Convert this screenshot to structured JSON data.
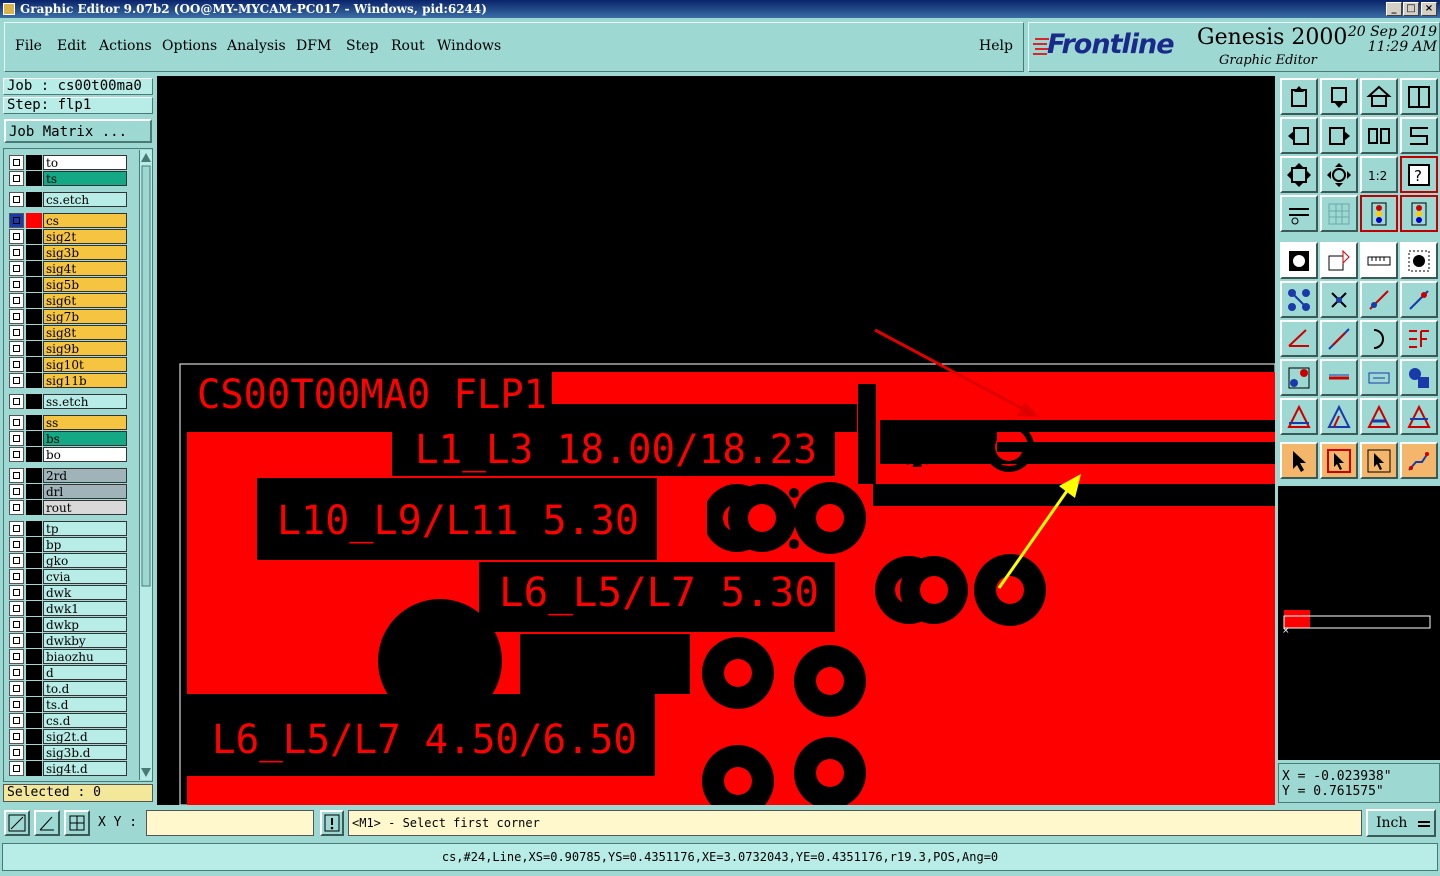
{
  "window": {
    "title": "Graphic Editor 9.07b2 (OO@MY-MYCAM-PC017 - Windows, pid:6244)",
    "buttons": [
      "_",
      "□",
      "×"
    ]
  },
  "menu": {
    "items": [
      "File",
      "Edit",
      "Actions",
      "Options",
      "Analysis",
      "DFM",
      "Step",
      "Rout",
      "Windows"
    ],
    "help": "Help"
  },
  "logo": {
    "brand": "Frontline",
    "product": "Genesis 2000",
    "subtitle": "Graphic Editor",
    "date": "20 Sep 2019",
    "time": "11:29 AM"
  },
  "job": {
    "job": "Job : cs00t00ma0",
    "step": "Step: flp1",
    "matrix_button": "Job Matrix ..."
  },
  "layers": [
    {
      "name": "to",
      "color": "#ffffff"
    },
    {
      "name": "ts",
      "color": "#14a884"
    },
    {
      "name": "cs.etch",
      "color": "#b8ece6"
    },
    {
      "name": "cs",
      "color": "#f5c542",
      "active": true
    },
    {
      "name": "sig2t",
      "color": "#f5c542"
    },
    {
      "name": "sig3b",
      "color": "#f5c542"
    },
    {
      "name": "sig4t",
      "color": "#f5c542"
    },
    {
      "name": "sig5b",
      "color": "#f5c542"
    },
    {
      "name": "sig6t",
      "color": "#f5c542"
    },
    {
      "name": "sig7b",
      "color": "#f5c542"
    },
    {
      "name": "sig8t",
      "color": "#f5c542"
    },
    {
      "name": "sig9b",
      "color": "#f5c542"
    },
    {
      "name": "sig10t",
      "color": "#f5c542"
    },
    {
      "name": "sig11b",
      "color": "#f5c542"
    },
    {
      "name": "ss.etch",
      "color": "#b8ece6"
    },
    {
      "name": "ss",
      "color": "#f5c542"
    },
    {
      "name": "bs",
      "color": "#14a884"
    },
    {
      "name": "bo",
      "color": "#ffffff"
    },
    {
      "name": "2rd",
      "color": "#9fb3b8"
    },
    {
      "name": "drl",
      "color": "#9fb3b8"
    },
    {
      "name": "rout",
      "color": "#d9d9d9"
    },
    {
      "name": "tp",
      "color": "#b8ece6"
    },
    {
      "name": "bp",
      "color": "#b8ece6"
    },
    {
      "name": "gko",
      "color": "#b8ece6"
    },
    {
      "name": "cvia",
      "color": "#b8ece6"
    },
    {
      "name": "dwk",
      "color": "#b8ece6"
    },
    {
      "name": "dwk1",
      "color": "#b8ece6"
    },
    {
      "name": "dwkp",
      "color": "#b8ece6"
    },
    {
      "name": "dwkby",
      "color": "#b8ece6"
    },
    {
      "name": "biaozhu",
      "color": "#b8ece6"
    },
    {
      "name": "d",
      "color": "#b8ece6"
    },
    {
      "name": "to.d",
      "color": "#b8ece6"
    },
    {
      "name": "ts.d",
      "color": "#b8ece6"
    },
    {
      "name": "cs.d",
      "color": "#b8ece6"
    },
    {
      "name": "sig2t.d",
      "color": "#b8ece6"
    },
    {
      "name": "sig3b.d",
      "color": "#b8ece6"
    },
    {
      "name": "sig4t.d",
      "color": "#b8ece6"
    }
  ],
  "selected": "Selected : 0",
  "canvas": {
    "texts": [
      "CS00T00MA0 FLP1",
      "L1_L3 18.00/18.23",
      "L10_L9/L11 5.30",
      "L6_L5/L7 5.30",
      "L6_L5/L7 4.50/6.50"
    ],
    "copper_color": "#ff0000",
    "arrow1_color": "#e00000",
    "arrow2_color": "#ffff00"
  },
  "coords": {
    "x": "X = -0.023938\"",
    "y": "Y = 0.761575\""
  },
  "command": {
    "xy_label": "X Y :",
    "xy_value": "",
    "prompt": "<M1> - Select first corner",
    "units": "Inch"
  },
  "status": "cs,#24,Line,XS=0.90785,YS=0.4351176,XE=3.0732043,YE=0.4351176,r19.3,POS,Ang=0"
}
